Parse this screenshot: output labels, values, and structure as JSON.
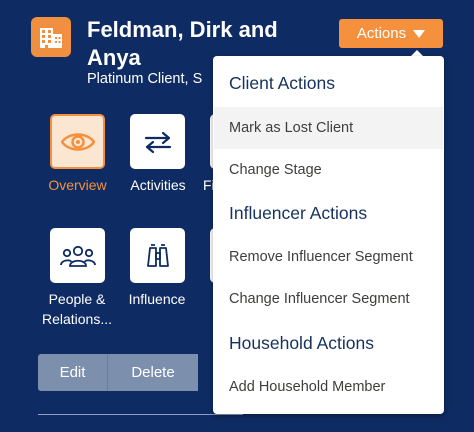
{
  "record": {
    "title": "Feldman, Dirk and Anya",
    "subtitle": "Platinum Client, S",
    "icon": "building-icon"
  },
  "actions_button": {
    "label": "Actions",
    "icon": "chevron-down-icon"
  },
  "quick_links": [
    {
      "label": "Overview",
      "icon": "eye-icon",
      "active": true
    },
    {
      "label": "Activities",
      "icon": "swap-arrows-icon",
      "active": false
    },
    {
      "label": "Fi",
      "icon": "",
      "active": false
    },
    {
      "label": "People & Relations...",
      "line1": "People &",
      "line2": "Relations...",
      "icon": "people-icon",
      "active": false
    },
    {
      "label": "Influence",
      "icon": "binoculars-icon",
      "active": false
    }
  ],
  "buttons": {
    "edit": "Edit",
    "delete": "Delete"
  },
  "menu": {
    "sections": [
      {
        "title": "Client Actions",
        "items": [
          "Mark as Lost Client",
          "Change Stage"
        ]
      },
      {
        "title": "Influencer Actions",
        "items": [
          "Remove Influencer Segment",
          "Change Influencer Segment"
        ]
      },
      {
        "title": "Household Actions",
        "items": [
          "Add Household Member"
        ]
      }
    ],
    "hovered_item": "Mark as Lost Client"
  },
  "colors": {
    "background": "#0e2c63",
    "accent": "#f5913d",
    "section_heading": "#16325c",
    "button_group": "#7c8fad"
  }
}
